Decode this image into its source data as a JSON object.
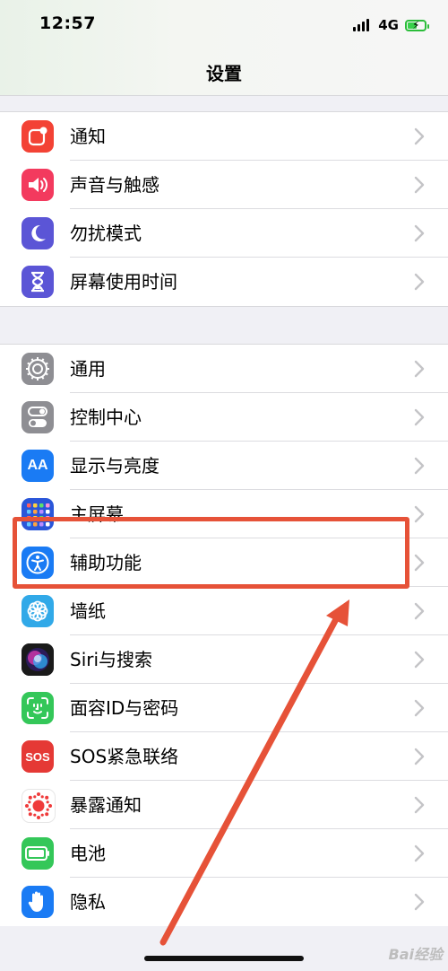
{
  "status_bar": {
    "time": "12:57",
    "network": "4G",
    "battery_level": 0.55
  },
  "nav": {
    "title": "设置"
  },
  "group1": [
    {
      "id": "notifications",
      "label": "通知",
      "icon": "notification-icon",
      "color": "#f34235"
    },
    {
      "id": "sounds",
      "label": "声音与触感",
      "icon": "speaker-icon",
      "color": "#f33a5e"
    },
    {
      "id": "dnd",
      "label": "勿扰模式",
      "icon": "moon-icon",
      "color": "#5b55d6"
    },
    {
      "id": "screentime",
      "label": "屏幕使用时间",
      "icon": "hourglass-icon",
      "color": "#5b55d6"
    }
  ],
  "group2": [
    {
      "id": "general",
      "label": "通用",
      "icon": "gear-icon",
      "color": "#8e8e93"
    },
    {
      "id": "control-center",
      "label": "控制中心",
      "icon": "toggle-icon",
      "color": "#8e8e93"
    },
    {
      "id": "display",
      "label": "显示与亮度",
      "icon": "text-size-icon",
      "color": "#1a7bf4"
    },
    {
      "id": "home-screen",
      "label": "主屏幕",
      "icon": "grid-icon",
      "color": "#2a56d9"
    },
    {
      "id": "accessibility",
      "label": "辅助功能",
      "icon": "accessibility-icon",
      "color": "#1a7bf4"
    },
    {
      "id": "wallpaper",
      "label": "墙纸",
      "icon": "flower-icon",
      "color": "#31a9e8"
    },
    {
      "id": "siri",
      "label": "Siri与搜索",
      "icon": "siri-icon",
      "color": "#222222"
    },
    {
      "id": "faceid",
      "label": "面容ID与密码",
      "icon": "face-id-icon",
      "color": "#34c759"
    },
    {
      "id": "sos",
      "label": "SOS紧急联络",
      "icon": "sos-icon",
      "color": "#e53935"
    },
    {
      "id": "exposure",
      "label": "暴露通知",
      "icon": "exposure-icon",
      "color": "#ffffff"
    },
    {
      "id": "battery",
      "label": "电池",
      "icon": "battery-icon",
      "color": "#34c759"
    },
    {
      "id": "privacy",
      "label": "隐私",
      "icon": "hand-icon",
      "color": "#1a7bf4"
    }
  ],
  "sos_text": "SOS",
  "text_size_icon_text": "AA",
  "watermark": "Bai经验",
  "annotation_color": "#e65238"
}
